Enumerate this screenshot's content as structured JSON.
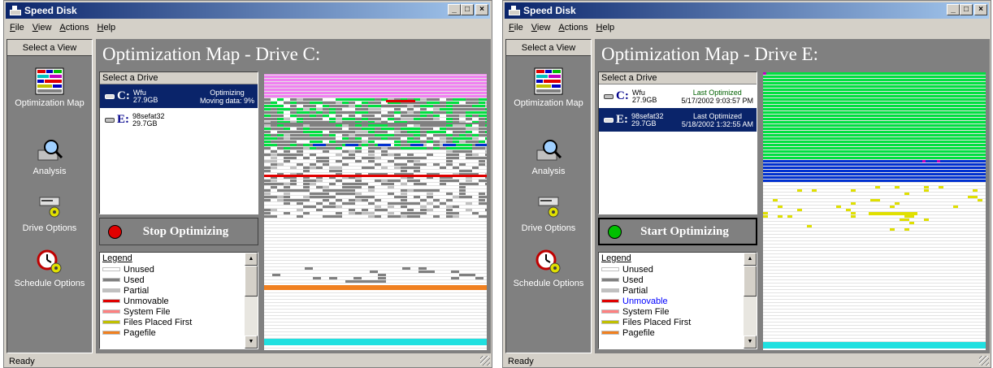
{
  "windows": [
    {
      "id": "w1",
      "title": "Speed Disk",
      "menu": [
        "File",
        "View",
        "Actions",
        "Help"
      ],
      "sidebar": {
        "header": "Select a View",
        "items": [
          "Optimization Map",
          "Analysis",
          "Drive Options",
          "Schedule Options"
        ]
      },
      "map_title": "Optimization Map - Drive C:",
      "drive_header": "Select a Drive",
      "drives": [
        {
          "letter": "C:",
          "name": "Wfu",
          "size": "27.9GB",
          "status1": "Optimizing",
          "status2": "Moving data: 9%",
          "selected": true
        },
        {
          "letter": "E:",
          "name": "98sefat32",
          "size": "29.7GB",
          "status1": "",
          "status2": "",
          "selected": false
        }
      ],
      "action_label": "Stop Optimizing",
      "action_led": "#e00000",
      "legend_header": "Legend",
      "legend": [
        {
          "label": "Unused",
          "color": "#ffffff"
        },
        {
          "label": "Used",
          "color": "#808080"
        },
        {
          "label": "Partial",
          "color": "#c0c0c0"
        },
        {
          "label": "Unmovable",
          "color": "#e00000"
        },
        {
          "label": "System File",
          "color": "#ff8080"
        },
        {
          "label": "Files Placed First",
          "color": "#c0c000"
        },
        {
          "label": "Pagefile",
          "color": "#f08020"
        }
      ],
      "status": "Ready"
    },
    {
      "id": "w2",
      "title": "Speed Disk",
      "menu": [
        "File",
        "View",
        "Actions",
        "Help"
      ],
      "sidebar": {
        "header": "Select a View",
        "items": [
          "Optimization Map",
          "Analysis",
          "Drive Options",
          "Schedule Options"
        ]
      },
      "map_title": "Optimization Map - Drive E:",
      "drive_header": "Select a Drive",
      "drives": [
        {
          "letter": "C:",
          "name": "Wfu",
          "size": "27.9GB",
          "status1": "Last Optimized",
          "status2": "5/17/2002 9:03:57 PM",
          "selected": false
        },
        {
          "letter": "E:",
          "name": "98sefat32",
          "size": "29.7GB",
          "status1": "Last Optimized",
          "status2": "5/18/2002 1:32:55 AM",
          "selected": true
        }
      ],
      "action_label": "Start Optimizing",
      "action_led": "#00c000",
      "legend_header": "Legend",
      "legend": [
        {
          "label": "Unused",
          "color": "#ffffff"
        },
        {
          "label": "Used",
          "color": "#808080"
        },
        {
          "label": "Partial",
          "color": "#c0c0c0"
        },
        {
          "label": "Unmovable",
          "color": "#e00000",
          "text_color": "#0000ff"
        },
        {
          "label": "System File",
          "color": "#ff8080"
        },
        {
          "label": "Files Placed First",
          "color": "#c0c000"
        },
        {
          "label": "Pagefile",
          "color": "#f08020"
        }
      ],
      "status": "Ready"
    }
  ],
  "colors": {
    "title_bar": "#0a246a",
    "panel": "#808080",
    "selection": "#0a246a",
    "dir_pink": "#f080f0",
    "green": "#00e040",
    "blue": "#0030d0",
    "cyan": "#20e0e0",
    "yellow": "#e0e000"
  }
}
